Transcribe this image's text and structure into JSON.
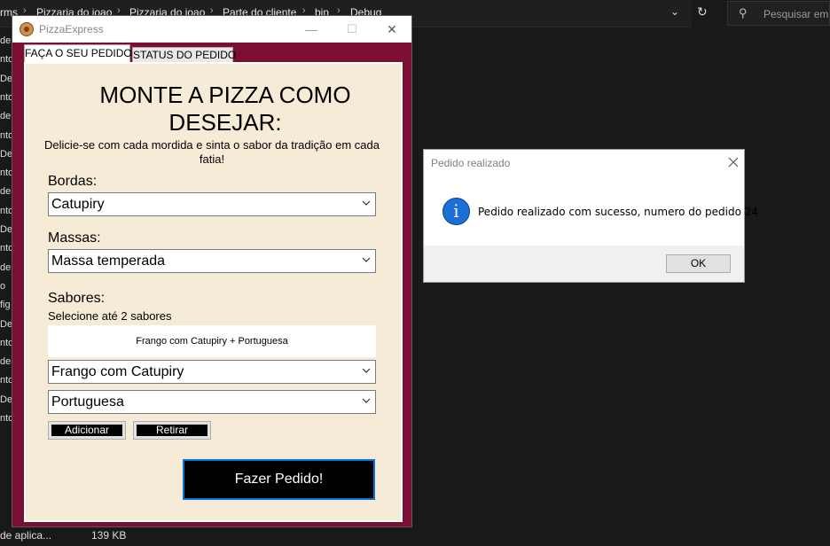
{
  "explorer": {
    "breadcrumbs": [
      "rms",
      "Pizzaria do joao",
      "Pizzaria do joao",
      "Parte do cliente",
      "bin",
      "Debug"
    ],
    "search_placeholder": "Pesquisar em D",
    "left_items": [
      "de",
      "nto",
      "De",
      "nto",
      "de",
      "nto",
      "De",
      "nto",
      "de",
      "nto",
      "De",
      "nto",
      "de",
      "o",
      "fig",
      "De",
      "nto",
      "de",
      "nto",
      "De",
      "nto"
    ],
    "status_type": "de aplica...",
    "status_size": "139 KB"
  },
  "window": {
    "title": "PizzaExpress",
    "minimize": "—",
    "maximize": "☐",
    "close": "✕",
    "tabs": [
      {
        "label": "FAÇA O SEU PEDIDO",
        "active": true
      },
      {
        "label": "STATUS DO PEDIDO",
        "active": false
      }
    ],
    "heading": "MONTE A PIZZA COMO DESEJAR:",
    "subtitle": "Delicie-se com cada mordida e sinta o sabor da tradição em cada fatia!",
    "bordas_label": "Bordas:",
    "bordas_value": "Catupiry",
    "massas_label": "Massas:",
    "massas_value": "Massa temperada",
    "sabores_label": "Sabores:",
    "sabores_hint": "Selecione até 2 sabores",
    "selected_flavors": "Frango com Catupiry + Portuguesa",
    "flavor1_value": "Frango com Catupiry",
    "flavor2_value": "Portuguesa",
    "add_button": "Adicionar",
    "remove_button": "Retirar",
    "order_button": "Fazer Pedido!"
  },
  "dialog": {
    "title": "Pedido realizado",
    "message": "Pedido realizado com sucesso, numero do pedido 24",
    "ok": "OK"
  },
  "colors": {
    "window_frame": "#7a0f33",
    "content_bg": "#f6ebd6",
    "info_icon": "#1c6fd6",
    "focus_border": "#0078d7"
  }
}
